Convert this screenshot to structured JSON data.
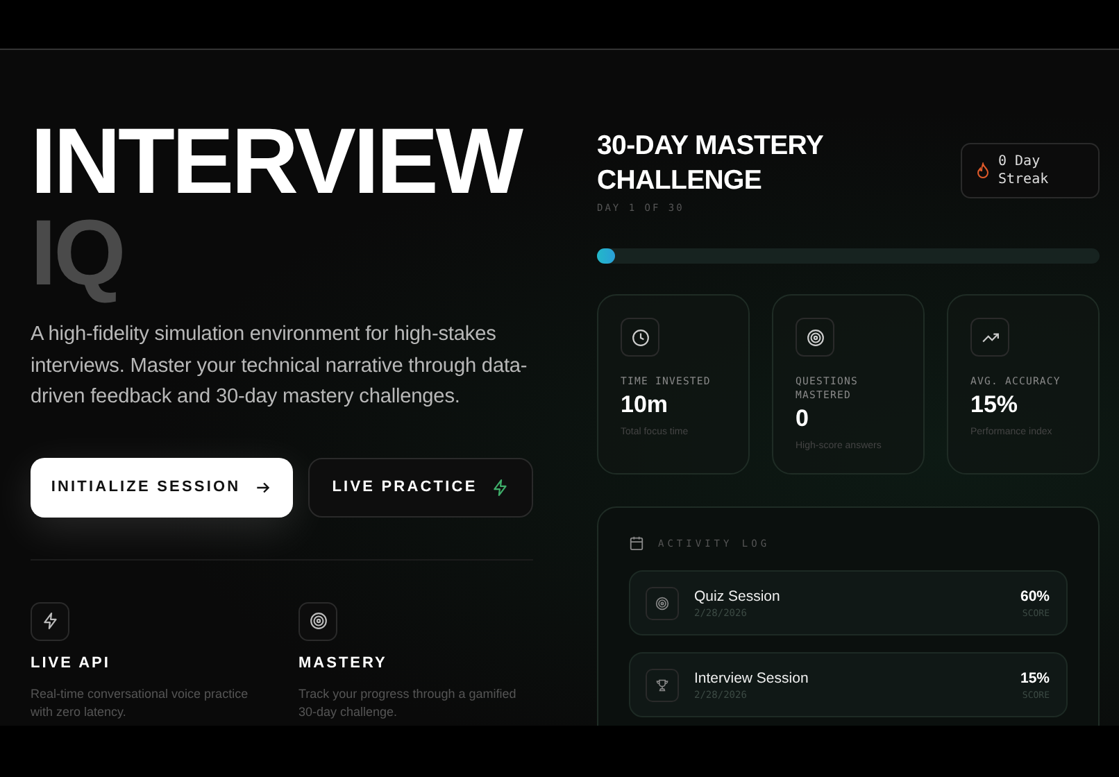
{
  "hero": {
    "title": "INTERVIEW",
    "title_accent": "IQ",
    "description": "A high-fidelity simulation environment for high-stakes interviews. Master your technical narrative through data-driven feedback and 30-day mastery challenges.",
    "primary_button": "INITIALIZE SESSION",
    "secondary_button": "LIVE PRACTICE"
  },
  "features": [
    {
      "kind": "bolt",
      "title": "LIVE API",
      "description": "Real-time conversational voice practice with zero latency."
    },
    {
      "kind": "target",
      "title": "MASTERY",
      "description": "Track your progress through a gamified 30-day challenge."
    }
  ],
  "challenge": {
    "title": "30-DAY MASTERY CHALLENGE",
    "subtitle": "DAY 1 OF 30",
    "streak": "0 Day Streak",
    "level": 0.035
  },
  "stats": [
    {
      "kind": "clock",
      "label": "TIME INVESTED",
      "value": "10m",
      "note": "Total focus time"
    },
    {
      "kind": "target",
      "label": "QUESTIONS MASTERED",
      "value": "0",
      "note": "High-score answers"
    },
    {
      "kind": "trend",
      "label": "AVG. ACCURACY",
      "value": "15%",
      "note": "Performance index"
    }
  ],
  "activity_log": {
    "title": "ACTIVITY LOG",
    "items": [
      {
        "kind": "quiz",
        "name": "Quiz Session",
        "date": "2/28/2026",
        "score": "60%",
        "score_label": "SCORE"
      },
      {
        "kind": "interview",
        "name": "Interview Session",
        "date": "2/28/2026",
        "score": "15%",
        "score_label": "SCORE"
      }
    ]
  }
}
